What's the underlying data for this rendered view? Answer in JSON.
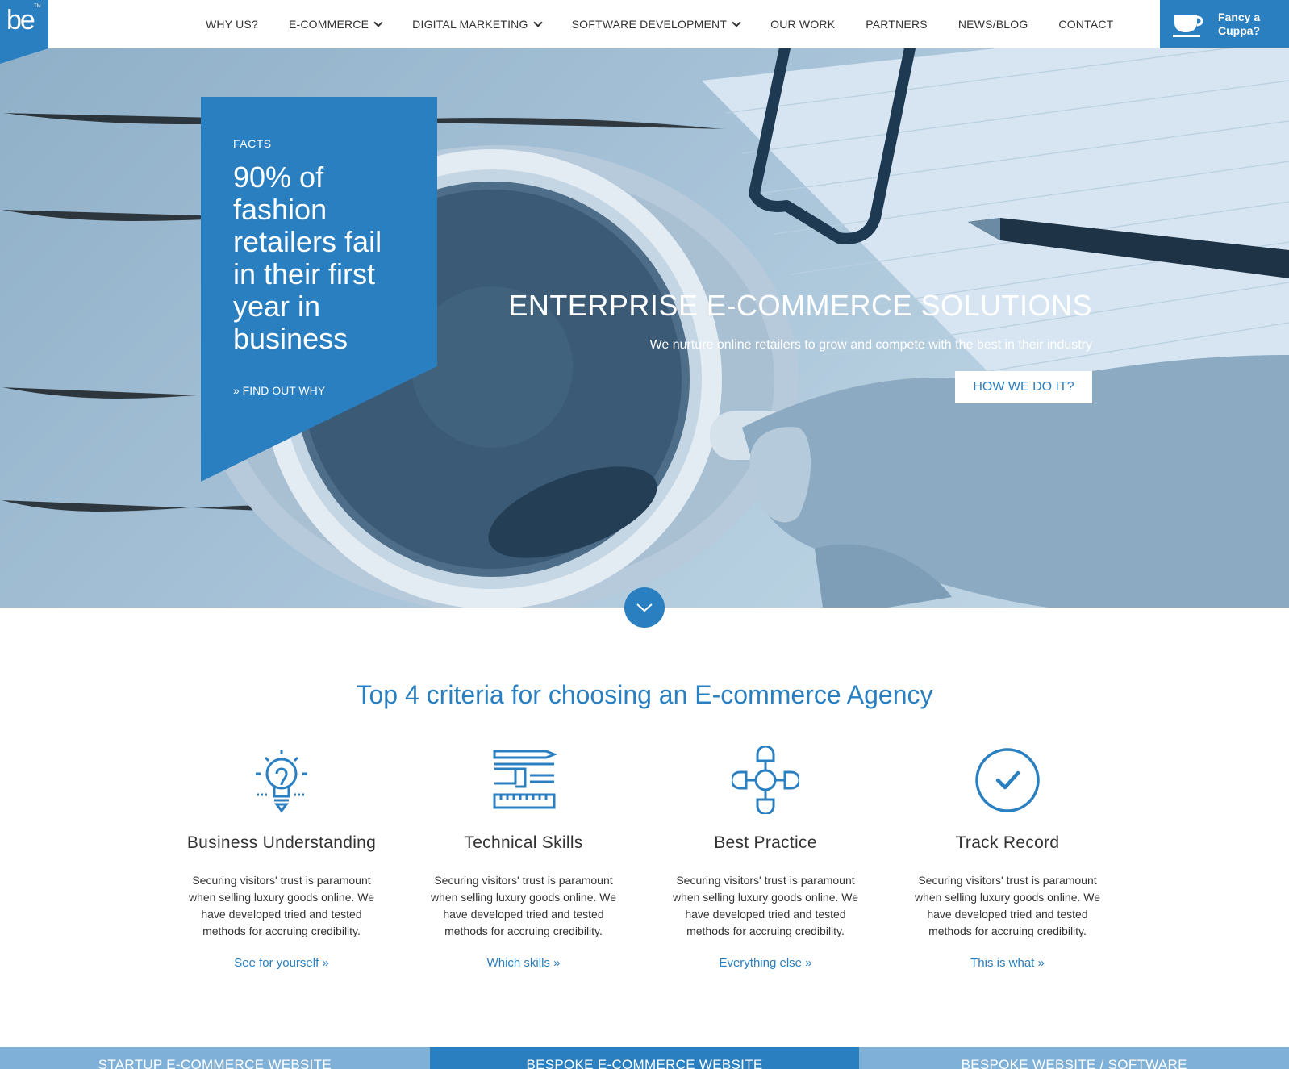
{
  "header": {
    "logo": {
      "text": "be",
      "tm": "TM"
    },
    "nav": [
      {
        "label": "WHY US?",
        "dropdown": false
      },
      {
        "label": "E-COMMERCE",
        "dropdown": true
      },
      {
        "label": "DIGITAL MARKETING",
        "dropdown": true
      },
      {
        "label": "SOFTWARE DEVELOPMENT",
        "dropdown": true
      },
      {
        "label": "OUR WORK",
        "dropdown": false
      },
      {
        "label": "PARTNERS",
        "dropdown": false
      },
      {
        "label": "NEWS/BLOG",
        "dropdown": false
      },
      {
        "label": "CONTACT",
        "dropdown": false
      }
    ],
    "cuppa": {
      "line1": "Fancy a",
      "line2": "Cuppa?",
      "icon": "cup-icon"
    }
  },
  "hero": {
    "facts": {
      "label": "FACTS",
      "headline": "90% of fashion retailers fail in their first year in business",
      "link": "» FIND OUT WHY"
    },
    "title": "ENTERPRISE E-COMMERCE SOLUTIONS",
    "subtitle": "We nurture online retailers to grow and compete with the best in their industry",
    "button": "HOW WE DO IT?",
    "scroll_icon": "chevron-down-icon"
  },
  "criteria": {
    "title": "Top 4 criteria for choosing an E-commerce Agency",
    "items": [
      {
        "icon": "lightbulb-icon",
        "title": "Business Understanding",
        "text": "Securing visitors' trust is paramount when selling luxury goods online. We have developed tried and tested methods for accruing credibility.",
        "link": "See for yourself »"
      },
      {
        "icon": "tools-icon",
        "title": "Technical Skills",
        "text": "Securing visitors' trust is paramount when selling luxury goods online. We have developed tried and tested methods for accruing credibility.",
        "link": "Which skills »"
      },
      {
        "icon": "molecule-icon",
        "title": "Best Practice",
        "text": "Securing visitors' trust is paramount when selling luxury goods online. We have developed tried and tested methods for accruing credibility.",
        "link": "Everything else »"
      },
      {
        "icon": "checkmark-circle-icon",
        "title": "Track Record",
        "text": "Securing visitors' trust is paramount when selling luxury goods online. We have developed tried and tested methods for accruing credibility.",
        "link": "This is what »"
      }
    ]
  },
  "tabs": [
    {
      "label": "STARTUP E-COMMERCE WEBSITE"
    },
    {
      "label": "BESPOKE E-COMMERCE WEBSITE"
    },
    {
      "label": "BESPOKE WEBSITE / SOFTWARE"
    }
  ],
  "colors": {
    "accent": "#2a7fc0",
    "tab_light": "#7fb0d8",
    "text": "#333333"
  }
}
